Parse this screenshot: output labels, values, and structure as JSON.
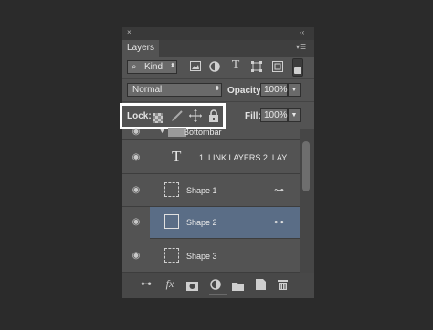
{
  "panel": {
    "close_glyph": "×",
    "collapse_glyph": "‹‹",
    "tab_label": "Layers",
    "menu_glyph": "▾☰"
  },
  "filter": {
    "kind_label": "Kind",
    "kind_icon": "search-icon",
    "icons": [
      "image-filter-icon",
      "adjustment-filter-icon",
      "type-filter-icon",
      "shape-filter-icon",
      "smart-object-filter-icon"
    ]
  },
  "blend": {
    "mode": "Normal",
    "opacity_label": "Opacity:",
    "opacity_value": "100%",
    "fill_label": "Fill:",
    "fill_value": "100%"
  },
  "lock": {
    "label": "Lock:",
    "icons": [
      "lock-transparent-icon",
      "lock-image-icon",
      "lock-position-icon",
      "lock-all-icon"
    ]
  },
  "layers": [
    {
      "name": "Bottombar",
      "type": "group",
      "visible": true,
      "selected": false
    },
    {
      "name": "1. LINK LAYERS 2. LAY...",
      "type": "text",
      "visible": true,
      "selected": false
    },
    {
      "name": "Shape 1",
      "type": "shape",
      "visible": true,
      "selected": false,
      "linked": true
    },
    {
      "name": "Shape 2",
      "type": "shape",
      "visible": true,
      "selected": true,
      "linked": true
    },
    {
      "name": "Shape 3",
      "type": "shape",
      "visible": true,
      "selected": false,
      "linked": false
    }
  ],
  "colors": {
    "panel_bg": "#535353",
    "selected_row": "#5a6d86",
    "highlight_box": "#ffffff"
  },
  "bottom_icons": [
    "link-layers-icon",
    "fx-icon",
    "add-mask-icon",
    "adjustment-layer-icon",
    "new-group-icon",
    "new-layer-icon",
    "delete-layer-icon"
  ],
  "bottom_labels": {
    "fx": "fx"
  }
}
